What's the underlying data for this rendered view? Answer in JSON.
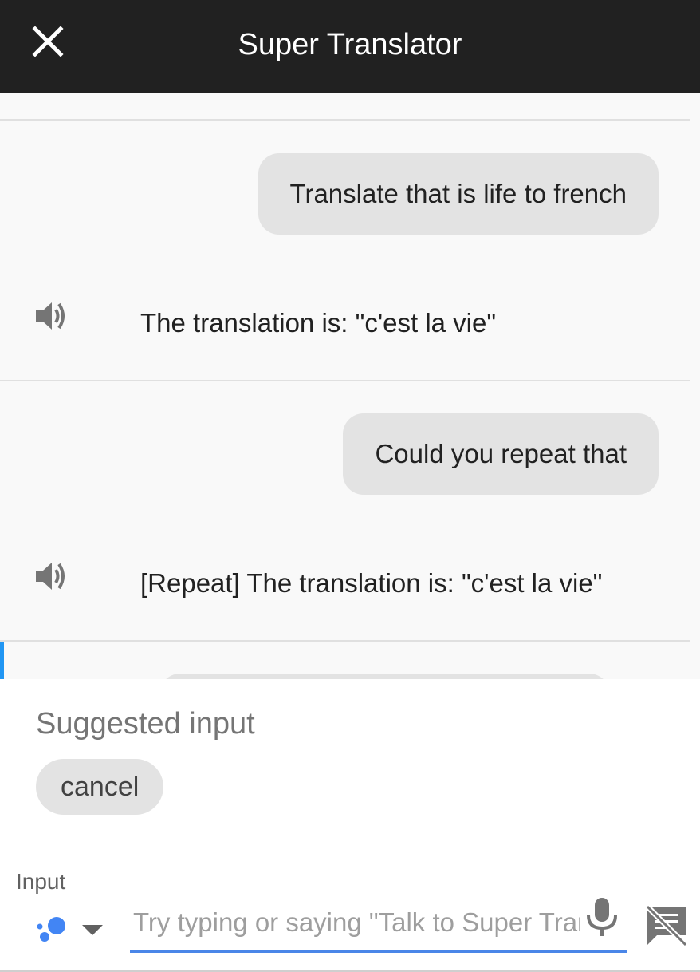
{
  "header": {
    "title": "Super Translator",
    "close_icon": "close-icon"
  },
  "conversation": {
    "turns": [
      {
        "user": "Translate that is life to french",
        "bot": "The translation is: \"c'est la vie\"",
        "bot_icon": "speaker-icon"
      },
      {
        "user": "Could you repeat that",
        "bot": "[Repeat] The translation is: \"c'est la vie\"",
        "bot_icon": "speaker-icon"
      }
    ]
  },
  "suggestions": {
    "title": "Suggested input",
    "chips": [
      "cancel"
    ]
  },
  "input": {
    "label": "Input",
    "placeholder": "Try typing or saying \"Talk to Super Translator\"",
    "value": "",
    "assistant_icon": "google-assistant-icon",
    "dropdown_icon": "chevron-down-icon",
    "mic_icon": "microphone-icon",
    "toggle_icon": "no-text-chat-icon"
  },
  "colors": {
    "header_bg": "#212121",
    "conversation_bg": "#f9f9f9",
    "bubble_bg": "#e3e3e3",
    "input_underline": "#4a86e8",
    "accent_marker": "#2196f3"
  }
}
